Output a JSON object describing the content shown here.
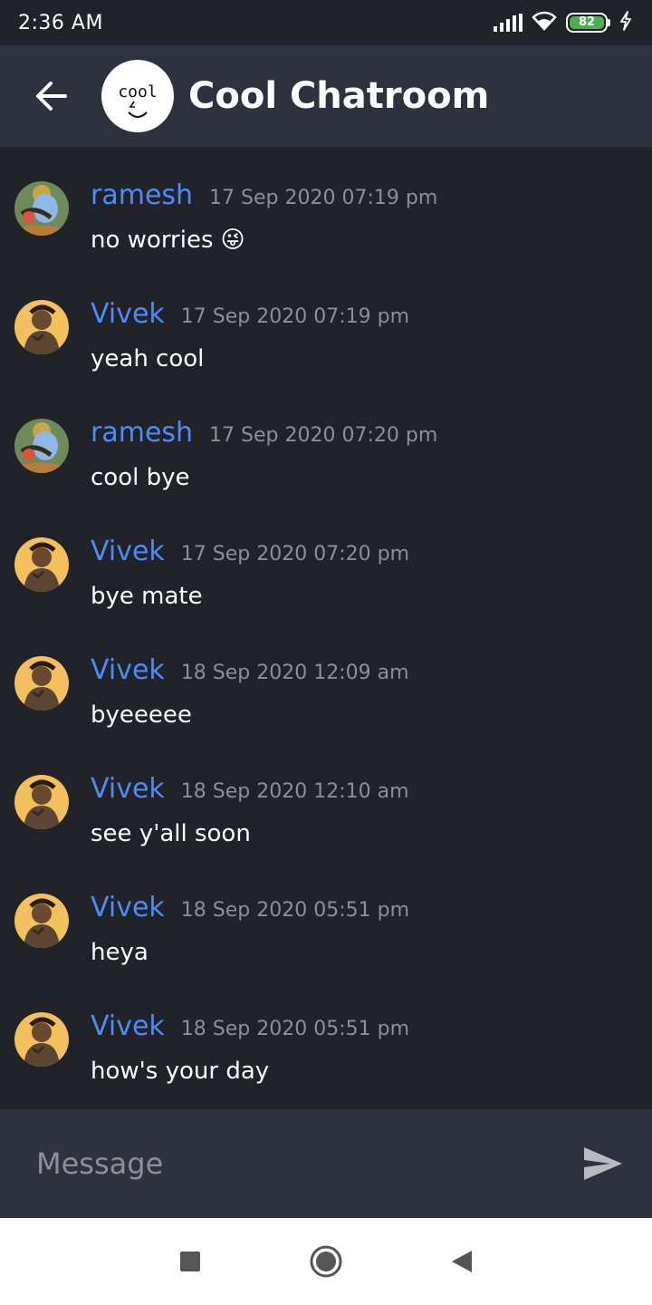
{
  "status_bar": {
    "time": "2:36 AM",
    "battery_percent": "82",
    "icons": [
      "signal-icon",
      "wifi-icon",
      "battery-icon",
      "charging-icon"
    ]
  },
  "header": {
    "title": "Cool Chatroom",
    "avatar_text": "cool",
    "back_icon": "arrow-left-icon"
  },
  "messages": [
    {
      "author": "ramesh",
      "time": "17 Sep 2020 07:19 pm",
      "text": "no worries",
      "emoji": "😜",
      "avatar": "ramesh-avatar"
    },
    {
      "author": "Vivek",
      "time": "17 Sep 2020 07:19 pm",
      "text": "yeah cool",
      "avatar": "vivek-avatar"
    },
    {
      "author": "ramesh",
      "time": "17 Sep 2020 07:20 pm",
      "text": "cool bye",
      "avatar": "ramesh-avatar"
    },
    {
      "author": "Vivek",
      "time": "17 Sep 2020 07:20 pm",
      "text": "bye mate",
      "avatar": "vivek-avatar"
    },
    {
      "author": "Vivek",
      "time": "18 Sep 2020 12:09 am",
      "text": "byeeeee",
      "avatar": "vivek-avatar"
    },
    {
      "author": "Vivek",
      "time": "18 Sep 2020 12:10 am",
      "text": "see y'all soon",
      "avatar": "vivek-avatar"
    },
    {
      "author": "Vivek",
      "time": "18 Sep 2020 05:51 pm",
      "text": "heya",
      "avatar": "vivek-avatar"
    },
    {
      "author": "Vivek",
      "time": "18 Sep 2020 05:51 pm",
      "text": "how's your day",
      "avatar": "vivek-avatar"
    }
  ],
  "composer": {
    "placeholder": "Message",
    "value": "",
    "send_icon": "send-icon"
  },
  "nav_bar": {
    "icons": [
      "recents-icon",
      "home-icon",
      "back-icon"
    ]
  },
  "colors": {
    "background": "#222328",
    "header": "#2e323e",
    "author": "#4d8bf5",
    "timestamp": "#8d8f96",
    "battery": "#4caf50"
  }
}
